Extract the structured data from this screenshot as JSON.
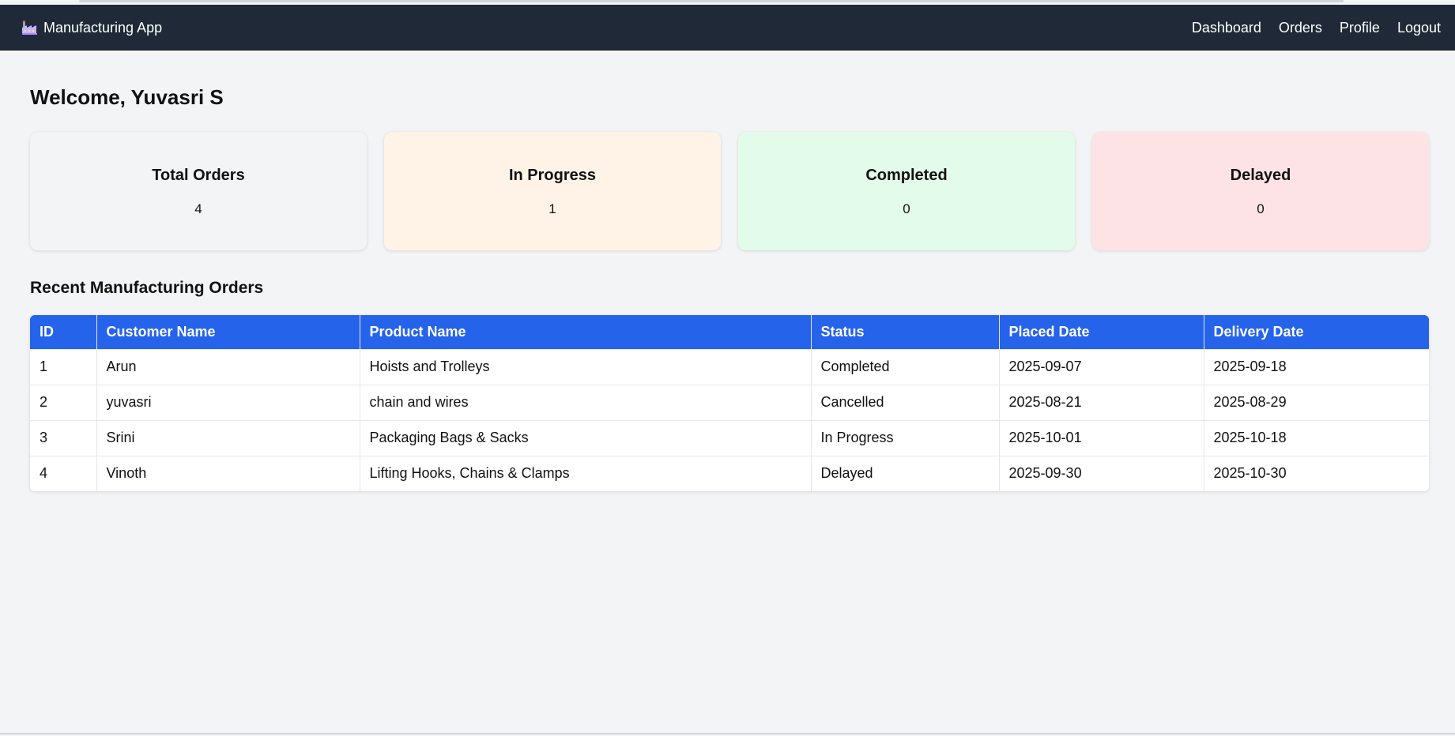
{
  "navbar": {
    "brand_icon": "factory-icon",
    "brand_label": "Manufacturing App",
    "links": [
      "Dashboard",
      "Orders",
      "Profile",
      "Logout"
    ]
  },
  "welcome": "Welcome, Yuvasri S",
  "cards": [
    {
      "title": "Total Orders",
      "count": "4",
      "color": "#f3f4f6"
    },
    {
      "title": "In Progress",
      "count": "1",
      "color": "#fef3e6"
    },
    {
      "title": "Completed",
      "count": "0",
      "color": "#e3fbea"
    },
    {
      "title": "Delayed",
      "count": "0",
      "color": "#fde3e5"
    }
  ],
  "section_title": "Recent Manufacturing Orders",
  "table": {
    "headers": [
      "ID",
      "Customer Name",
      "Product Name",
      "Status",
      "Placed Date",
      "Delivery Date"
    ],
    "rows": [
      [
        "1",
        "Arun",
        "Hoists and Trolleys",
        "Completed",
        "2025-09-07",
        "2025-09-18"
      ],
      [
        "2",
        "yuvasri",
        "chain and wires",
        "Cancelled",
        "2025-08-21",
        "2025-08-29"
      ],
      [
        "3",
        "Srini",
        "Packaging Bags & Sacks",
        "In Progress",
        "2025-10-01",
        "2025-10-18"
      ],
      [
        "4",
        "Vinoth",
        "Lifting Hooks, Chains & Clamps",
        "Delayed",
        "2025-09-30",
        "2025-10-30"
      ]
    ]
  },
  "colors": {
    "navbar_bg": "#1f2937",
    "table_header_bg": "#2563eb",
    "page_bg": "#f3f4f6"
  }
}
